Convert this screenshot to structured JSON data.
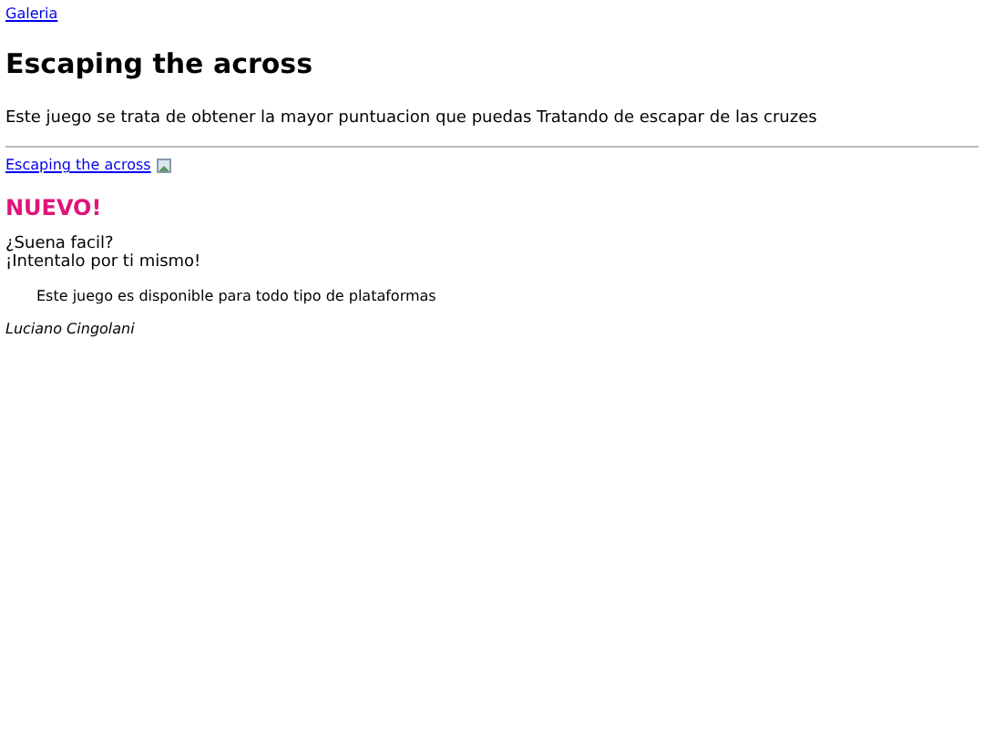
{
  "nav_link": "Galeria",
  "title": "Escaping the across",
  "description": "Este juego se trata de obtener la mayor puntuacion que puedas Tratando de escapar de las cruzes",
  "game_link": "Escaping the across",
  "badge": "NUEVO!",
  "tagline": [
    "¿Suena facil?",
    "¡Intentalo por ti mismo!"
  ],
  "note": "Este juego es disponible para todo tipo de plataformas",
  "author": "Luciano Cingolani"
}
